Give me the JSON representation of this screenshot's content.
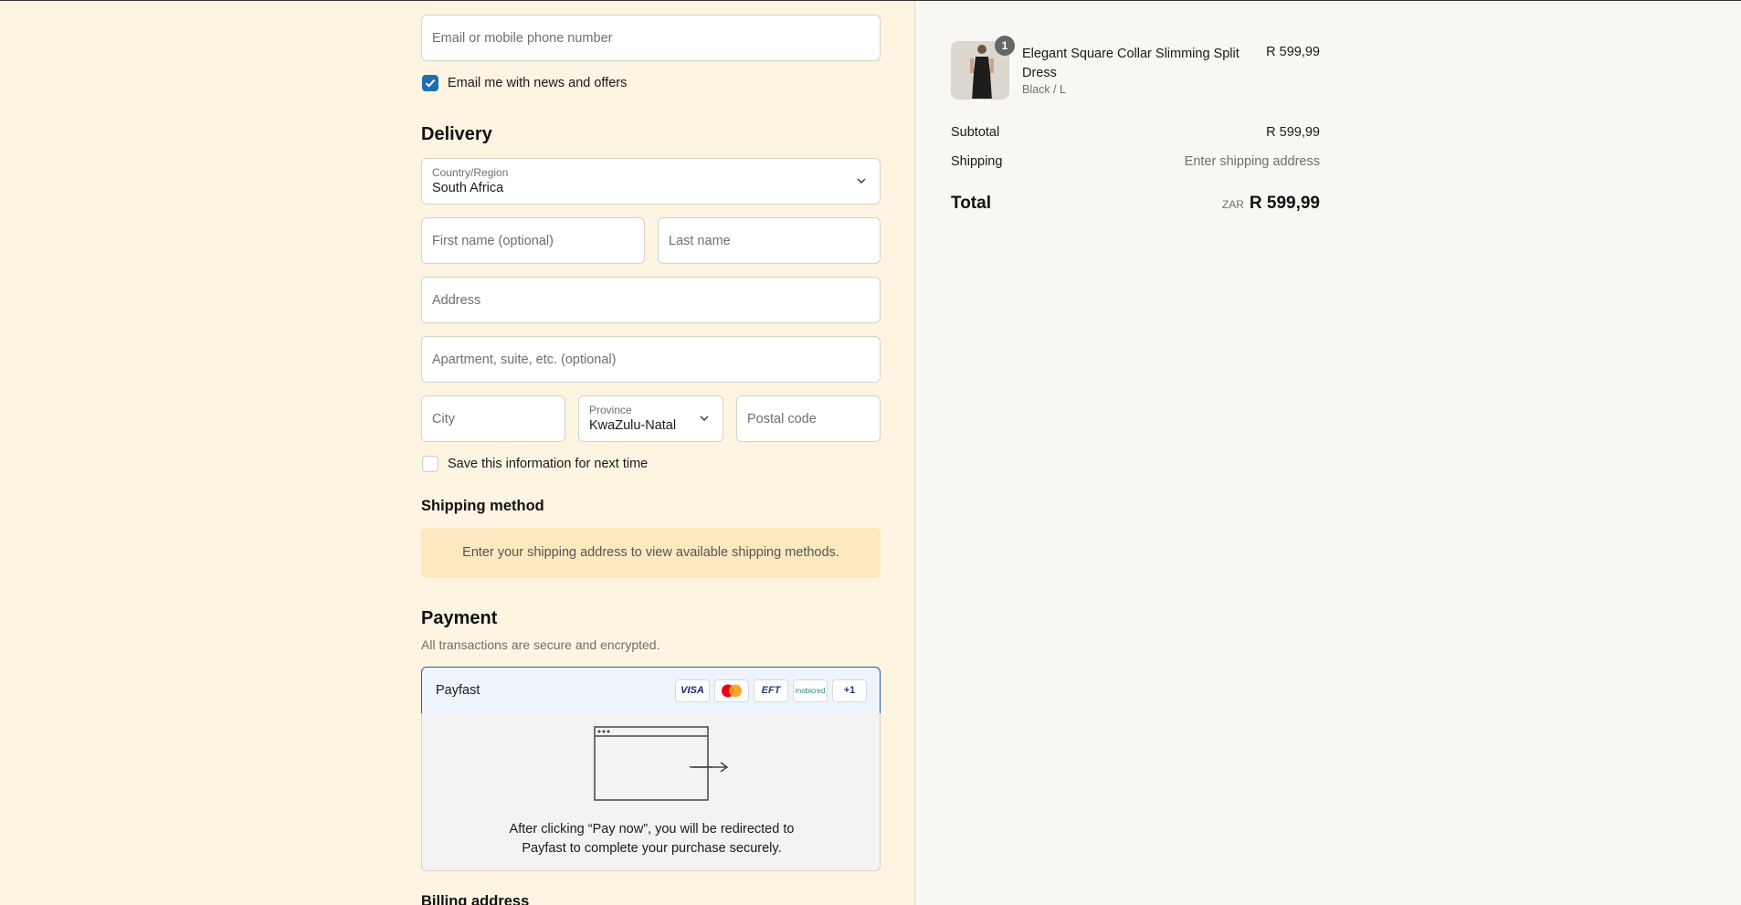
{
  "contact": {
    "email_placeholder": "Email or mobile phone number",
    "news_label": "Email me with news and offers",
    "news_checked": true
  },
  "delivery": {
    "heading": "Delivery",
    "country_label": "Country/Region",
    "country_value": "South Africa",
    "first_name_placeholder": "First name (optional)",
    "last_name_placeholder": "Last name",
    "address_placeholder": "Address",
    "apartment_placeholder": "Apartment, suite, etc. (optional)",
    "city_placeholder": "City",
    "province_label": "Province",
    "province_value": "KwaZulu-Natal",
    "postal_placeholder": "Postal code",
    "save_label": "Save this information for next time",
    "save_checked": false
  },
  "shipping_method": {
    "heading": "Shipping method",
    "notice": "Enter your shipping address to view available shipping methods."
  },
  "payment": {
    "heading": "Payment",
    "subtitle": "All transactions are secure and encrypted.",
    "provider": "Payfast",
    "badges": [
      "VISA",
      "mastercard-icon",
      "EFT",
      "mobicred",
      "+1"
    ],
    "more_label": "+1",
    "eft_label": "EFT",
    "visa_label": "VISA",
    "mobicred_label": "mobicred",
    "redirect_line1": "After clicking “Pay now”, you will be redirected to",
    "redirect_line2": "Payfast to complete your purchase securely."
  },
  "billing": {
    "heading": "Billing address"
  },
  "summary": {
    "item": {
      "quantity": "1",
      "name": "Elegant Square Collar Slimming Split Dress",
      "variant": "Black / L",
      "price": "R 599,99"
    },
    "subtotal_label": "Subtotal",
    "subtotal_value": "R 599,99",
    "shipping_label": "Shipping",
    "shipping_value": "Enter shipping address",
    "total_label": "Total",
    "currency": "ZAR",
    "total_value": "R 599,99"
  },
  "colors": {
    "left_bg": "#fdf4e1",
    "right_bg": "#f8f7f3",
    "accent": "#1f6fb2",
    "notice_bg": "#fde9bf"
  }
}
